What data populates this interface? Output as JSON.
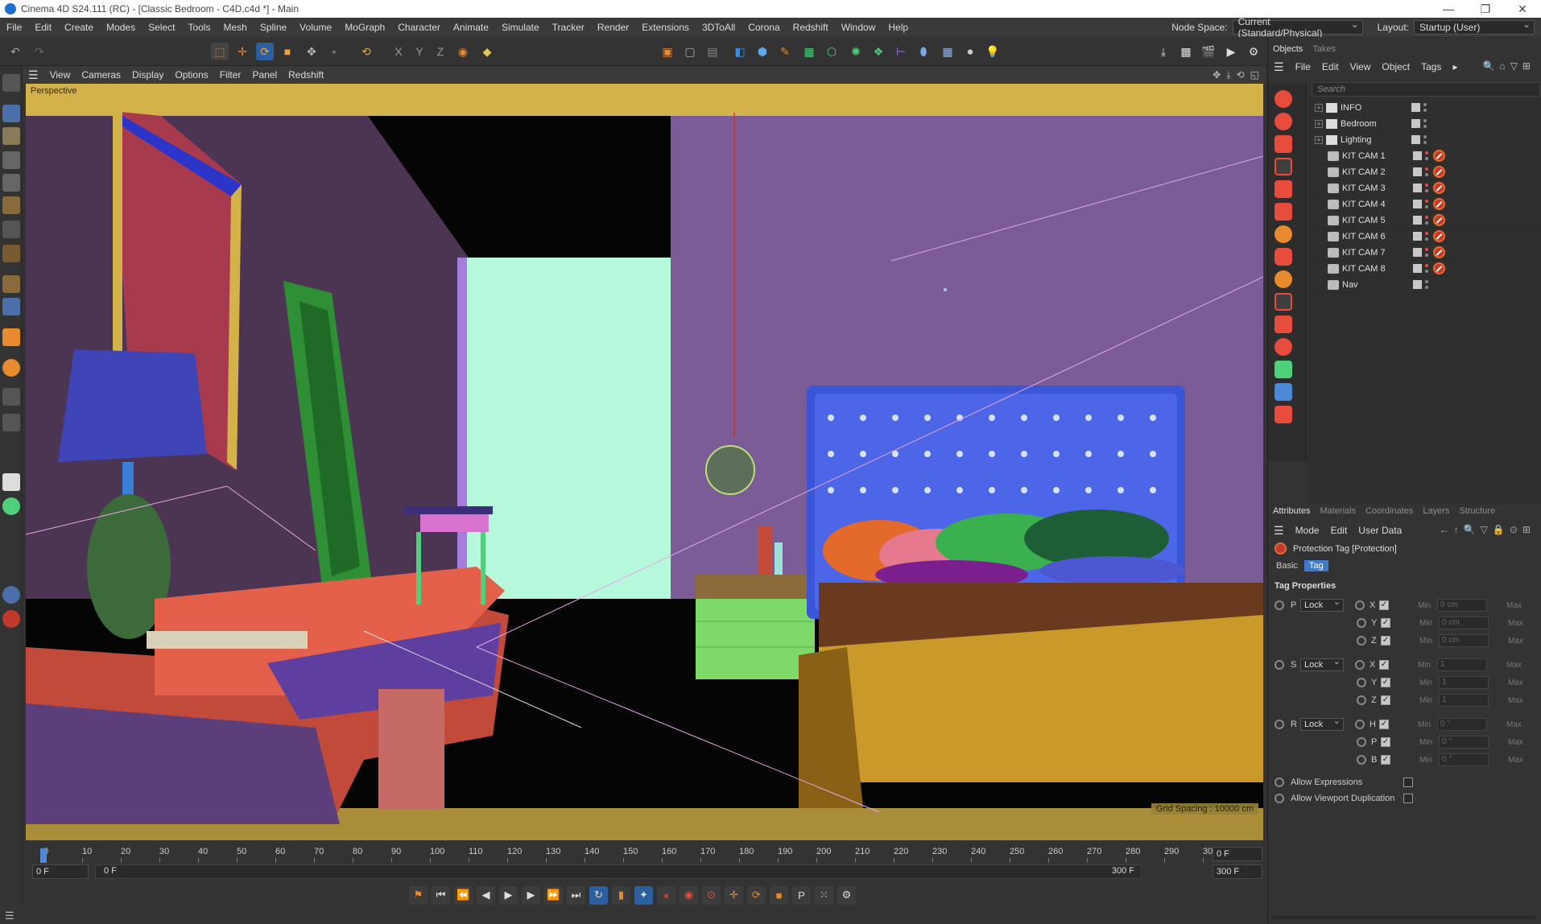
{
  "window": {
    "title": "Cinema 4D S24.111 (RC) - [Classic Bedroom - C4D.c4d *] - Main",
    "controls": [
      "—",
      "❐",
      "✕"
    ]
  },
  "menu": {
    "items": [
      "File",
      "Edit",
      "Create",
      "Modes",
      "Select",
      "Tools",
      "Mesh",
      "Spline",
      "Volume",
      "MoGraph",
      "Character",
      "Animate",
      "Simulate",
      "Tracker",
      "Render",
      "Extensions",
      "3DToAll",
      "Corona",
      "Redshift",
      "Window",
      "Help"
    ],
    "node_space_label": "Node Space:",
    "node_space_value": "Current (Standard/Physical)",
    "layout_label": "Layout:",
    "layout_value": "Startup (User)"
  },
  "viewport": {
    "menu": [
      "View",
      "Cameras",
      "Display",
      "Options",
      "Filter",
      "Panel",
      "Redshift"
    ],
    "label": "Perspective",
    "grid_spacing": "Grid Spacing : 10000 cm"
  },
  "timeline": {
    "ticks": [
      "0",
      "10",
      "20",
      "30",
      "40",
      "50",
      "60",
      "70",
      "80",
      "90",
      "100",
      "110",
      "120",
      "130",
      "140",
      "150",
      "160",
      "170",
      "180",
      "190",
      "200",
      "210",
      "220",
      "230",
      "240",
      "250",
      "260",
      "270",
      "280",
      "290",
      "30"
    ],
    "current_frame": "0 F",
    "start_field": "0 F",
    "range_start": "0 F",
    "range_end": "300 F",
    "end_field": "300 F",
    "playhead_frame": 0
  },
  "objects_panel": {
    "tabs": [
      "Objects",
      "Takes"
    ],
    "menu": [
      "File",
      "Edit",
      "View",
      "Object",
      "Tags"
    ],
    "search_placeholder": "Search",
    "items": [
      {
        "name": "INFO",
        "type": "layer",
        "tag": false
      },
      {
        "name": "Bedroom",
        "type": "layer",
        "tag": false
      },
      {
        "name": "Lighting",
        "type": "layer",
        "tag": false
      },
      {
        "name": "KIT CAM 1",
        "type": "camera",
        "tag": true
      },
      {
        "name": "KIT CAM 2",
        "type": "camera",
        "tag": true
      },
      {
        "name": "KIT CAM 3",
        "type": "camera",
        "tag": true
      },
      {
        "name": "KIT CAM 4",
        "type": "camera",
        "tag": true
      },
      {
        "name": "KIT CAM 5",
        "type": "camera",
        "tag": true
      },
      {
        "name": "KIT CAM 6",
        "type": "camera",
        "tag": true
      },
      {
        "name": "KIT CAM 7",
        "type": "camera",
        "tag": true
      },
      {
        "name": "KIT CAM 8",
        "type": "camera",
        "tag": true
      },
      {
        "name": "Nav",
        "type": "camera",
        "tag": false
      }
    ]
  },
  "attributes_panel": {
    "tabs": [
      "Attributes",
      "Materials",
      "Coordinates",
      "Layers",
      "Structure"
    ],
    "menu": [
      "Mode",
      "Edit",
      "User Data"
    ],
    "object_title": "Protection Tag [Protection]",
    "subtabs": [
      "Basic",
      "Tag"
    ],
    "section_title": "Tag Properties",
    "groups": [
      {
        "label": "P",
        "mode": "Lock",
        "axes": [
          {
            "axis": "X",
            "min": "0 cm"
          },
          {
            "axis": "Y",
            "min": "0 cm"
          },
          {
            "axis": "Z",
            "min": "0 cm"
          }
        ]
      },
      {
        "label": "S",
        "mode": "Lock",
        "axes": [
          {
            "axis": "X",
            "min": "1"
          },
          {
            "axis": "Y",
            "min": "1"
          },
          {
            "axis": "Z",
            "min": "1"
          }
        ]
      },
      {
        "label": "R",
        "mode": "Lock",
        "axes": [
          {
            "axis": "H",
            "min": "0 °"
          },
          {
            "axis": "P",
            "min": "0 °"
          },
          {
            "axis": "B",
            "min": "0 °"
          }
        ]
      }
    ],
    "min_label": "Min",
    "max_label": "Max",
    "options": [
      {
        "label": "Allow Expressions",
        "checked": false
      },
      {
        "label": "Allow Viewport Duplication",
        "checked": false
      }
    ]
  }
}
